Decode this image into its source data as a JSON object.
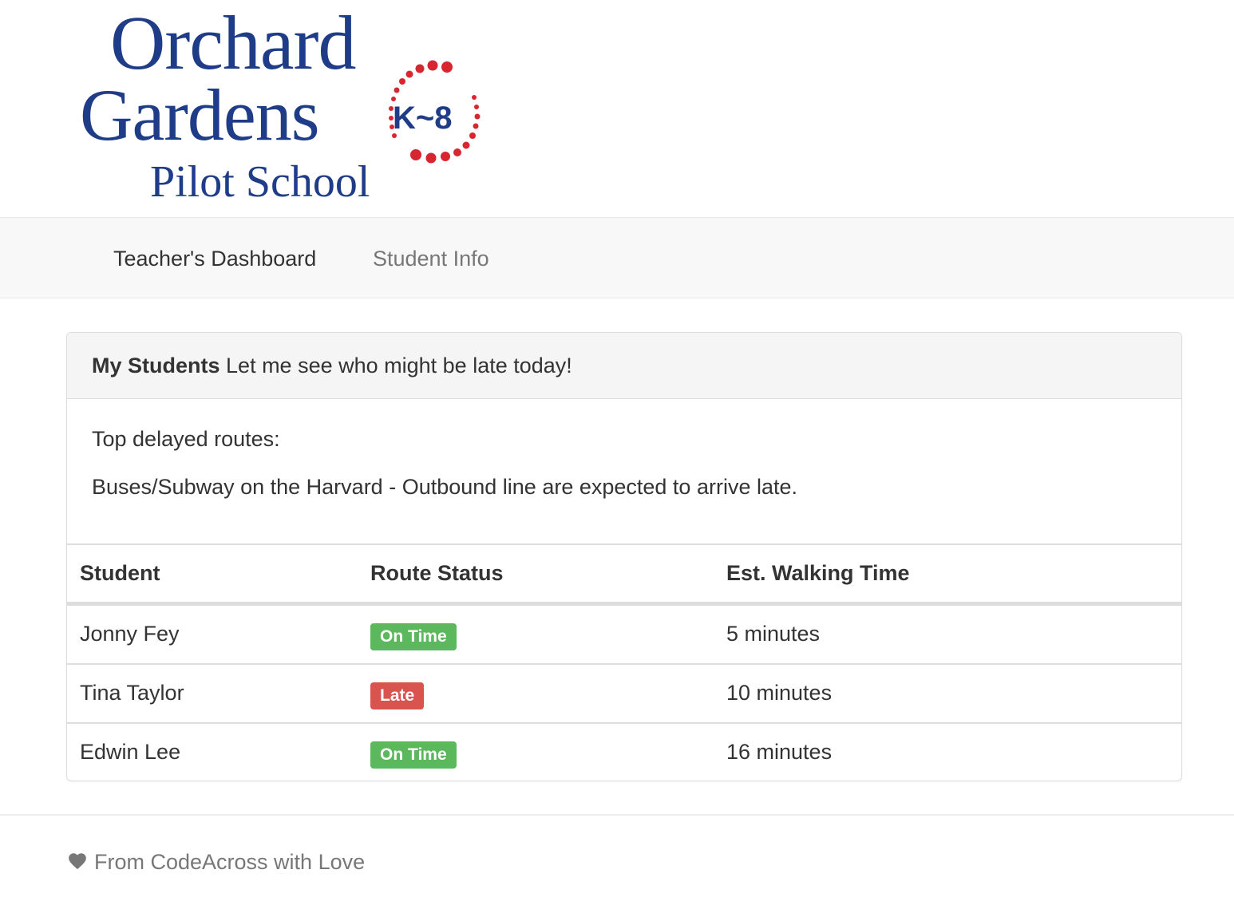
{
  "logo": {
    "line1": "Orchard",
    "line2": "Gardens",
    "line3": "Pilot School",
    "grades": "K~8"
  },
  "navbar": {
    "items": [
      {
        "label": "Teacher's Dashboard",
        "active": true
      },
      {
        "label": "Student Info",
        "active": false
      }
    ]
  },
  "panel": {
    "title_bold": "My Students",
    "title_rest": "Let me see who might be late today!",
    "routes_label": "Top delayed routes:",
    "routes_message": "Buses/Subway on the Harvard - Outbound line are expected to arrive late."
  },
  "table": {
    "headers": [
      "Student",
      "Route Status",
      "Est. Walking Time"
    ],
    "rows": [
      {
        "student": "Jonny Fey",
        "status": "On Time",
        "status_color": "#5cb85c",
        "walking_time": "5 minutes"
      },
      {
        "student": "Tina Taylor",
        "status": "Late",
        "status_color": "#d9534f",
        "walking_time": "10 minutes"
      },
      {
        "student": "Edwin Lee",
        "status": "On Time",
        "status_color": "#5cb85c",
        "walking_time": "16 minutes"
      }
    ]
  },
  "footer": {
    "icon": "heart-icon",
    "text": "From CodeAcross with Love"
  },
  "colors": {
    "brand_blue": "#1f3c88",
    "logo_dots": "#d7262f",
    "success": "#5cb85c",
    "danger": "#d9534f"
  }
}
